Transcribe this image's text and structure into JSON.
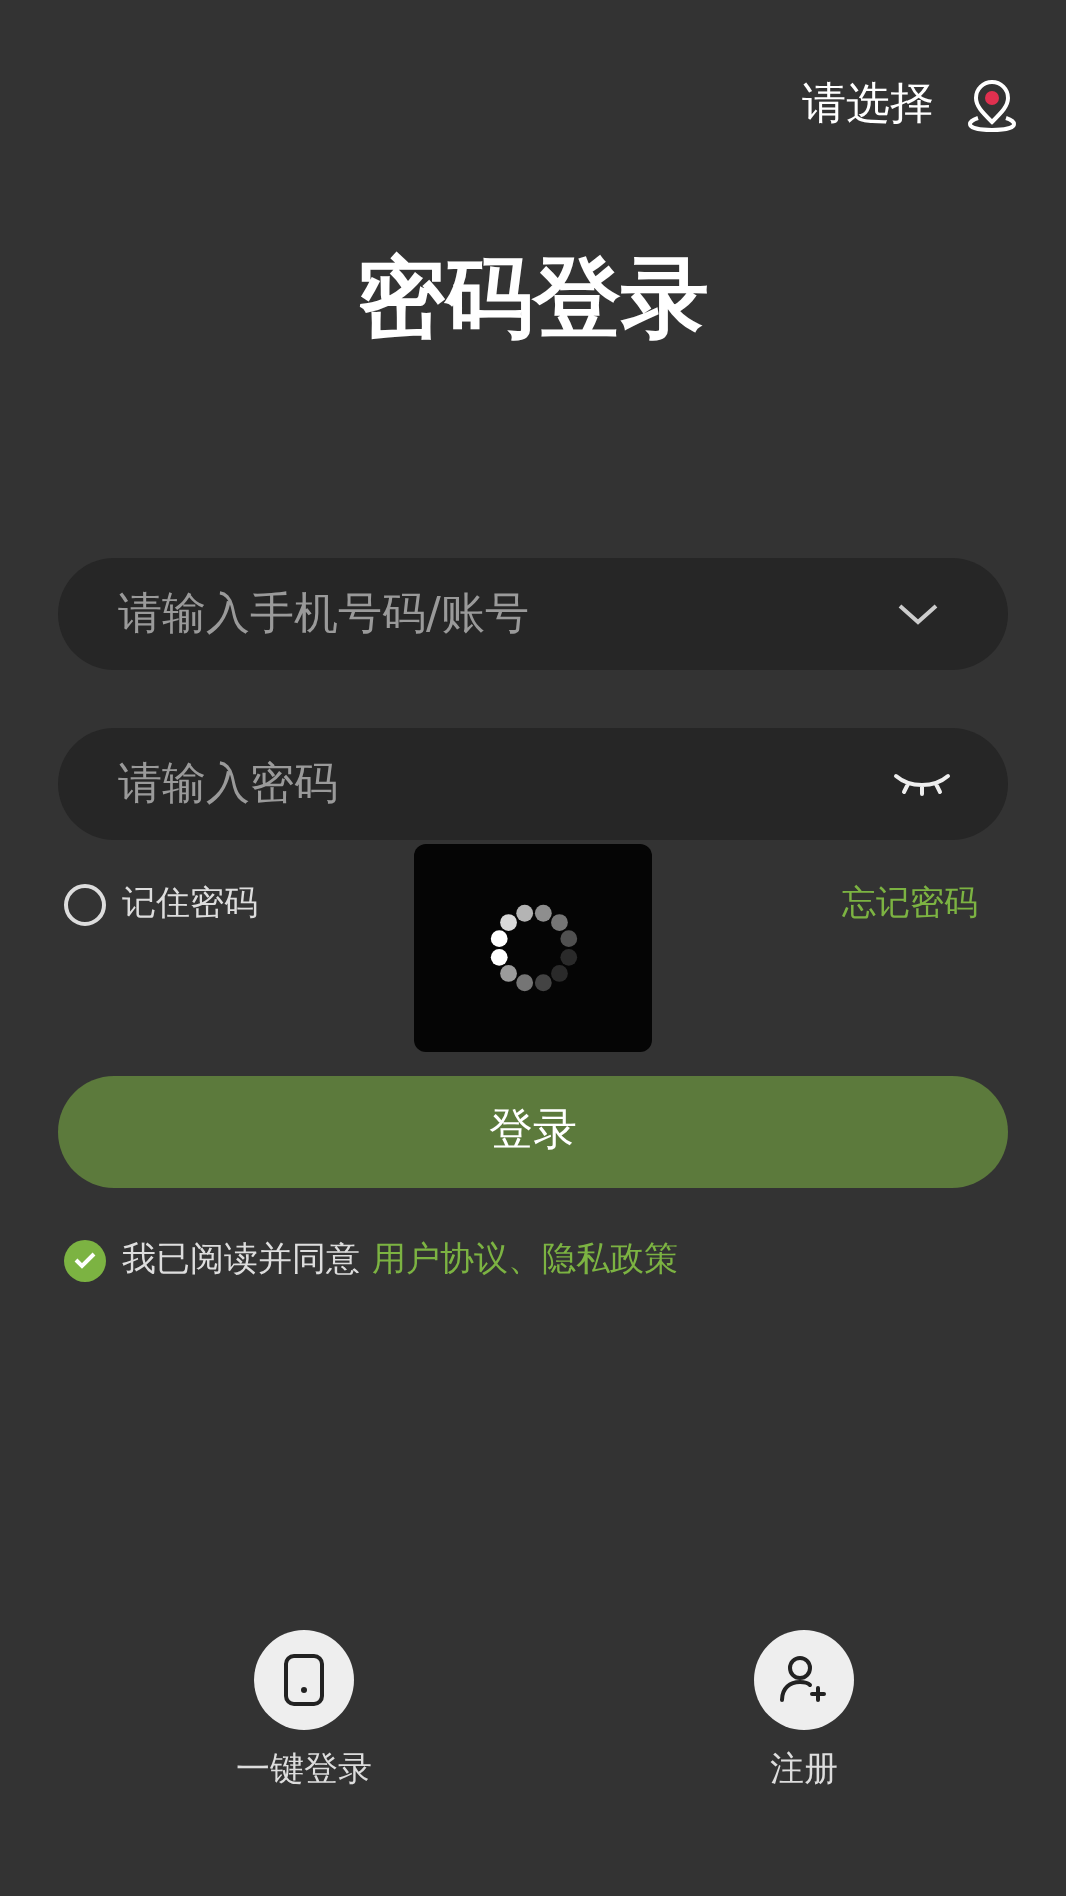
{
  "location": {
    "label": "请选择"
  },
  "title": "密码登录",
  "account_field": {
    "placeholder": "请输入手机号码/账号"
  },
  "password_field": {
    "placeholder": "请输入密码"
  },
  "remember": {
    "label": "记住密码",
    "checked": false
  },
  "forgot_link": "忘记密码",
  "login_button": "登录",
  "agreement": {
    "checked": true,
    "text": "我已阅读并同意",
    "links": [
      "用户协议",
      "隐私政策"
    ],
    "separator": "、"
  },
  "loading": {
    "visible": true
  },
  "bottom_actions": [
    {
      "kind": "phone",
      "label": "一键登录"
    },
    {
      "kind": "register",
      "label": "注册"
    }
  ]
}
